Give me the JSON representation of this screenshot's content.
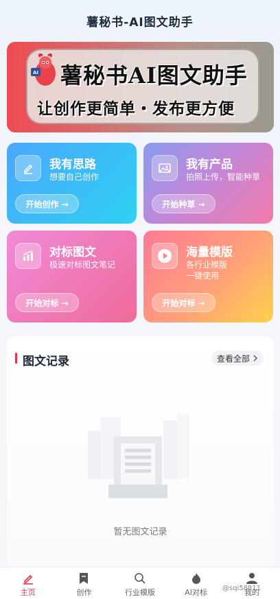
{
  "header": {
    "title": "薯秘书-AI图文助手"
  },
  "banner": {
    "line1": "薯秘书AI图文助手",
    "line2": "让创作更简单・发布更方便",
    "mascot_badge": "AI"
  },
  "cards": [
    {
      "title": "我有思路",
      "subtitle": "想要自己创作",
      "button": "开始创作 →",
      "icon": "pencil-icon"
    },
    {
      "title": "我有产品",
      "subtitle": "拍照上传，智能种草",
      "button": "开始种草 →",
      "icon": "image-icon"
    },
    {
      "title": "对标图文",
      "subtitle": "极速对标图文笔记",
      "button": "开始对标 →",
      "icon": "chart-icon"
    },
    {
      "title": "海量模版",
      "subtitle": "各行业模版",
      "subtitle2": "一键使用",
      "button": "开始对标 →",
      "icon": "play-icon"
    }
  ],
  "records": {
    "title": "图文记录",
    "view_all": "查看全部",
    "empty_text": "暂无图文记录"
  },
  "tabbar": {
    "items": [
      {
        "label": "主页",
        "icon": "home-icon",
        "active": true
      },
      {
        "label": "创作",
        "icon": "bookmark-icon",
        "active": false
      },
      {
        "label": "行业模版",
        "icon": "search-icon",
        "active": false
      },
      {
        "label": "AI对标",
        "icon": "fire-icon",
        "active": false
      },
      {
        "label": "我的",
        "icon": "user-icon",
        "active": false
      }
    ]
  },
  "watermark": "@sqi58811",
  "colors": {
    "accent": "#e8304b"
  }
}
